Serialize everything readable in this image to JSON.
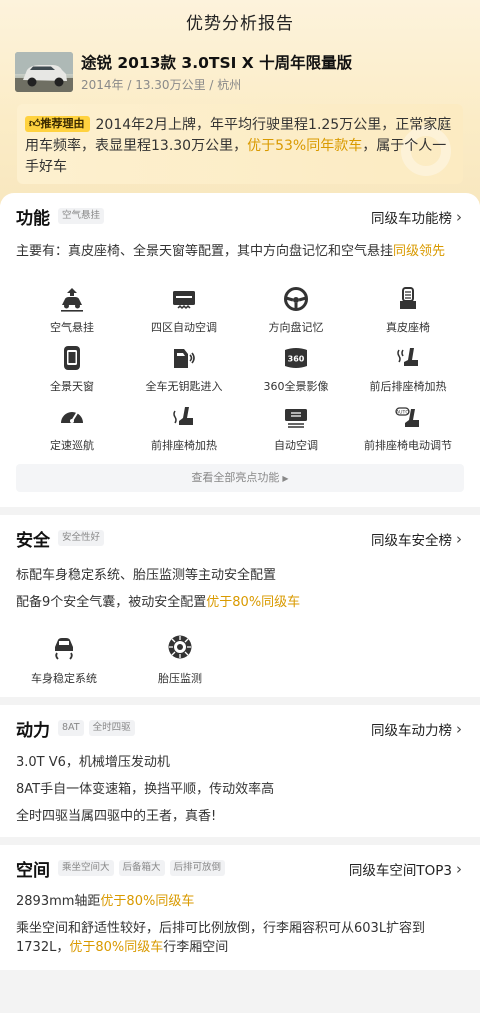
{
  "page_title": "优势分析报告",
  "car": {
    "name": "途锐 2013款 3.0TSI X 十周年限量版",
    "meta": "2014年 / 13.30万公里 / 杭州"
  },
  "recommend": {
    "badge": "推荐理由",
    "text_1": "2014年2月上牌，年平均行驶里程1.25万公里，正常家庭用车频率，表显里程13.30万公里，",
    "highlight": "优于53%同年款车",
    "text_2": "，属于个人一手好车"
  },
  "colors": {
    "accent": "#d99a00",
    "badge": "#ffd23f",
    "header_bg": "#fbecc6"
  },
  "function": {
    "title": "功能",
    "tag": "空气悬挂",
    "rank": "同级车功能榜",
    "summary_1": "主要有：真皮座椅、全景天窗等配置，其中方向盘记忆和空气悬挂",
    "summary_hl": "同级领先",
    "items": [
      {
        "label": "空气悬挂",
        "icon": "air-suspension-icon"
      },
      {
        "label": "四区自动空调",
        "icon": "four-zone-ac-icon"
      },
      {
        "label": "方向盘记忆",
        "icon": "steering-wheel-icon"
      },
      {
        "label": "真皮座椅",
        "icon": "leather-seat-icon"
      },
      {
        "label": "全景天窗",
        "icon": "panoramic-sunroof-icon"
      },
      {
        "label": "全车无钥匙进入",
        "icon": "keyless-entry-icon"
      },
      {
        "label": "360全景影像",
        "icon": "camera-360-icon"
      },
      {
        "label": "前后排座椅加热",
        "icon": "seat-heating-icon"
      },
      {
        "label": "定速巡航",
        "icon": "cruise-control-icon"
      },
      {
        "label": "前排座椅加热",
        "icon": "front-seat-heating-icon"
      },
      {
        "label": "自动空调",
        "icon": "auto-ac-icon"
      },
      {
        "label": "前排座椅电动调节",
        "icon": "power-seat-icon"
      }
    ],
    "see_all": "查看全部亮点功能"
  },
  "safety": {
    "title": "安全",
    "tag": "安全性好",
    "rank": "同级车安全榜",
    "line_1": "标配车身稳定系统、胎压监测等主动安全配置",
    "line_2": "配备9个安全气囊，被动安全配置",
    "line_2_hl": "优于80%同级车",
    "items": [
      {
        "label": "车身稳定系统",
        "icon": "stability-control-icon"
      },
      {
        "label": "胎压监测",
        "icon": "tire-pressure-icon"
      }
    ]
  },
  "power": {
    "title": "动力",
    "tags": [
      "8AT",
      "全时四驱"
    ],
    "rank": "同级车动力榜",
    "lines": [
      "3.0T V6，机械增压发动机",
      "8AT手自一体变速箱，换挡平顺，传动效率高",
      "全时四驱当属四驱中的王者，真香!"
    ]
  },
  "space": {
    "title": "空间",
    "tags": [
      "乘坐空间大",
      "后备箱大",
      "后排可放倒"
    ],
    "rank": "同级车空间TOP3",
    "line_1": "2893mm轴距",
    "line_1_hl": "优于80%同级车",
    "line_2": "乘坐空间和舒适性较好，后排可比例放倒，行李厢容积可从603L扩容到",
    "line_3_pre": "1732L，",
    "line_3_hl": "优于80%同级车",
    "line_3_post": "行李厢空间"
  }
}
